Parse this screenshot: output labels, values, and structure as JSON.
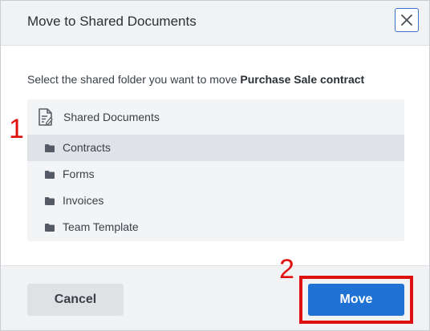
{
  "dialog": {
    "title": "Move to Shared Documents",
    "close_icon": "close-icon",
    "prompt_prefix": "Select the shared folder you want to move ",
    "document_name": "Purchase Sale contract"
  },
  "tree": {
    "root": {
      "label": "Shared Documents",
      "icon": "document-icon"
    },
    "folders": [
      {
        "label": "Contracts",
        "selected": true,
        "icon": "folder-icon"
      },
      {
        "label": "Forms",
        "selected": false,
        "icon": "folder-icon"
      },
      {
        "label": "Invoices",
        "selected": false,
        "icon": "folder-icon"
      },
      {
        "label": "Team Template",
        "selected": false,
        "icon": "folder-icon"
      }
    ]
  },
  "annotations": {
    "marker_1": "1",
    "marker_2": "2",
    "color": "#e01010"
  },
  "footer": {
    "cancel_label": "Cancel",
    "move_label": "Move"
  },
  "colors": {
    "accent": "#1f72d4",
    "selected_row": "#dfe2e7",
    "panel": "#f3f4f6"
  }
}
